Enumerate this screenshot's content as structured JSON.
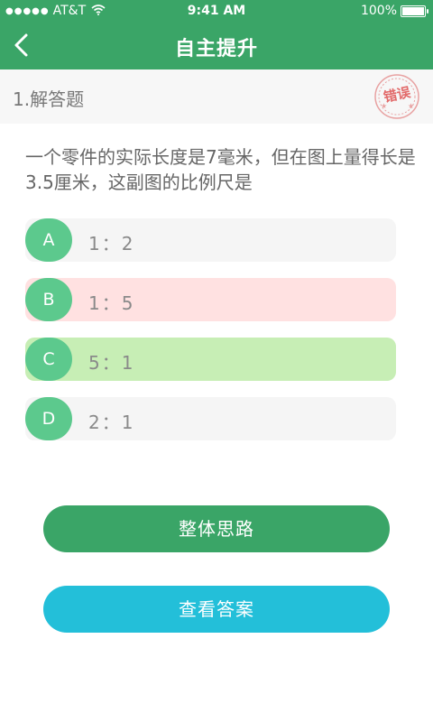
{
  "status_bar": {
    "carrier": "AT&T",
    "time": "9:41 AM",
    "battery": "100%",
    "battery_level": 1.0
  },
  "nav": {
    "title": "自主提升",
    "back_icon": "chevron-left-icon"
  },
  "question_header": {
    "number_label": "1.解答题",
    "stamp_label": "错误"
  },
  "question": {
    "text": "一个零件的实际长度是7毫米，但在图上量得长是3.5厘米，这副图的比例尺是"
  },
  "options": [
    {
      "letter": "A",
      "text": "1：2",
      "state": "default",
      "color": "#f5f5f5"
    },
    {
      "letter": "B",
      "text": "1：5",
      "state": "wrong",
      "color": "#ffe1e1"
    },
    {
      "letter": "C",
      "text": "5：1",
      "state": "correct",
      "color": "#c7eeb5"
    },
    {
      "letter": "D",
      "text": "2：1",
      "state": "default",
      "color": "#f5f5f5"
    }
  ],
  "buttons": {
    "overall_thinking": "整体思路",
    "view_answer": "查看答案"
  },
  "colors": {
    "primary_green": "#3aa567",
    "option_letter_green": "#5cc98d",
    "answer_button_blue": "#23bfd9",
    "stamp_red": "#e26a6a"
  }
}
